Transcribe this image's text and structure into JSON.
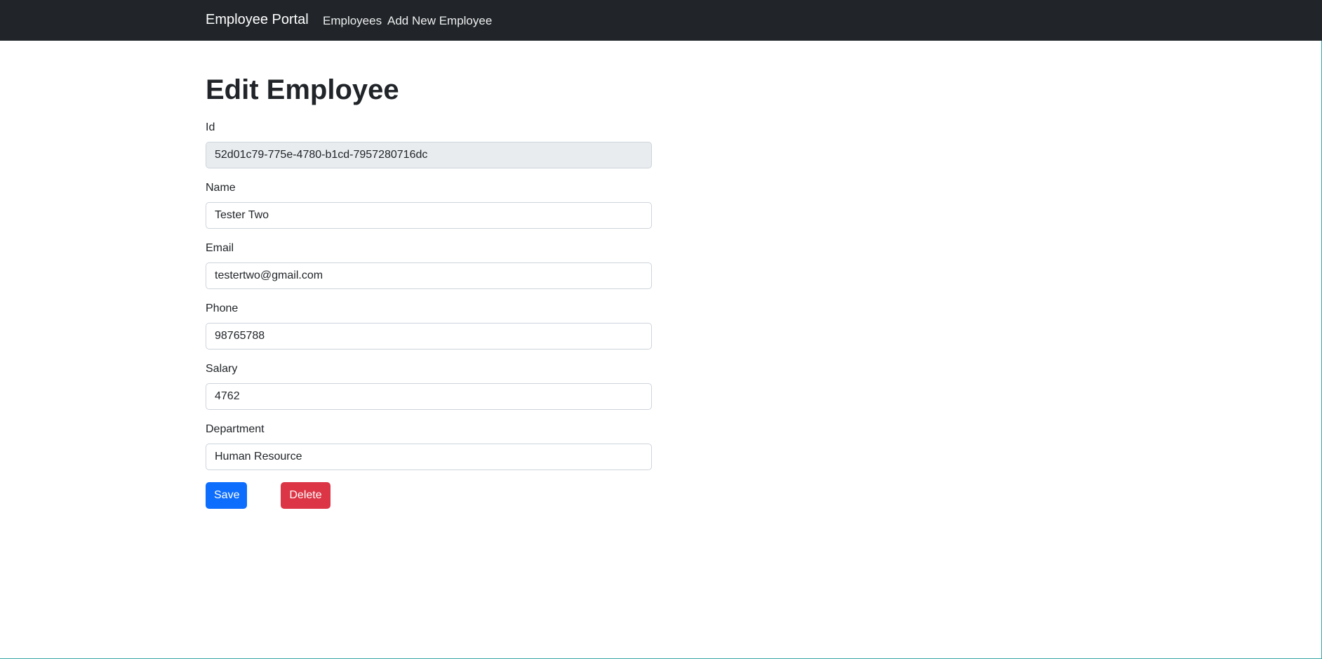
{
  "navbar": {
    "brand": "Employee Portal",
    "links": [
      {
        "label": "Employees"
      },
      {
        "label": "Add New Employee"
      }
    ]
  },
  "page": {
    "title": "Edit Employee"
  },
  "form": {
    "id": {
      "label": "Id",
      "value": "52d01c79-775e-4780-b1cd-7957280716dc"
    },
    "name": {
      "label": "Name",
      "value": "Tester Two"
    },
    "email": {
      "label": "Email",
      "value": "testertwo@gmail.com"
    },
    "phone": {
      "label": "Phone",
      "value": "98765788"
    },
    "salary": {
      "label": "Salary",
      "value": "4762"
    },
    "department": {
      "label": "Department",
      "value": "Human Resource"
    }
  },
  "actions": {
    "save_label": "Save",
    "delete_label": "Delete"
  },
  "colors": {
    "navbar_bg": "#212529",
    "save_button": "#0d6efd",
    "delete_button": "#dc3545",
    "readonly_input_bg": "#e9ecef"
  }
}
